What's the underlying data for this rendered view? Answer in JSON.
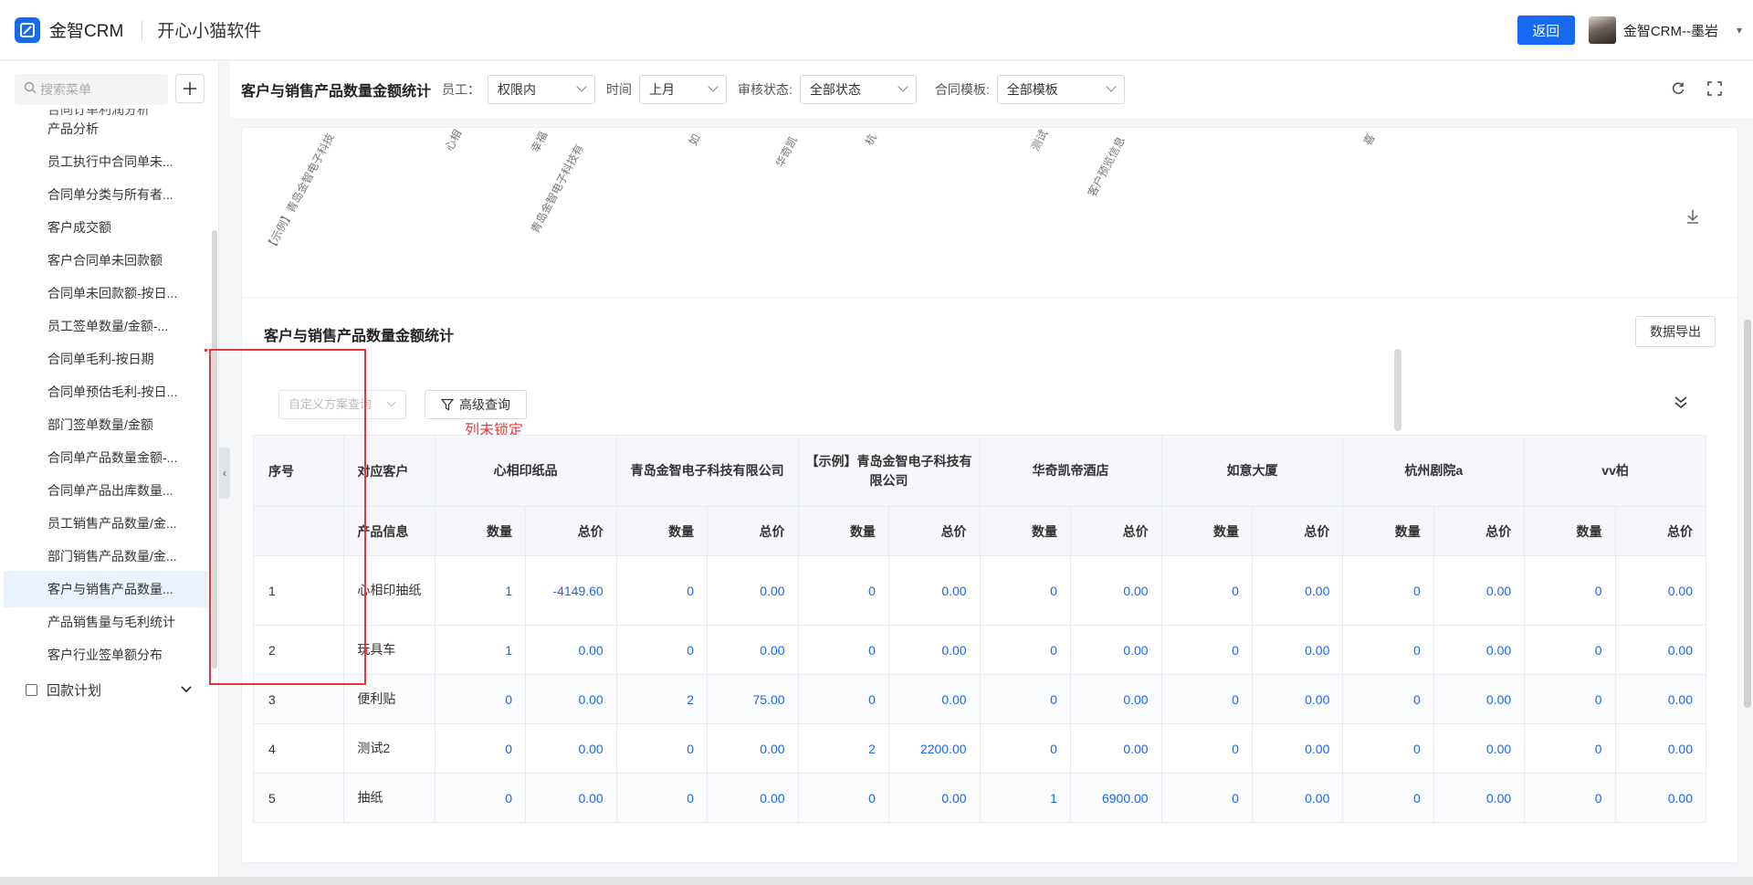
{
  "header": {
    "logo_text": "金智CRM",
    "company": "开心小猫软件",
    "back_label": "返回",
    "user_name": "金智CRM--墨岩"
  },
  "sidebar": {
    "search_placeholder": "搜索菜单",
    "cut_item": "合同订单利润分析",
    "items": [
      "产品分析",
      "员工执行中合同单未...",
      "合同单分类与所有者...",
      "客户成交额",
      "客户合同单未回款额",
      "合同单未回款额-按日...",
      "员工签单数量/金额-...",
      "合同单毛利-按日期",
      "合同单预估毛利-按日...",
      "部门签单数量/金额",
      "合同单产品数量金额-...",
      "合同单产品出库数量...",
      "员工销售产品数量/金...",
      "部门销售产品数量/金...",
      "客户与销售产品数量...",
      "产品销售量与毛利统计",
      "客户行业签单额分布"
    ],
    "active_index": 14,
    "group": "回款计划"
  },
  "filters": {
    "page_title": "客户与销售产品数量金额统计",
    "employee_label": "员工：",
    "employee_value": "权限内",
    "time_label": "时间",
    "time_value": "上月",
    "audit_label": "审核状态:",
    "audit_value": "全部状态",
    "template_label": "合同模板:",
    "template_value": "全部模板"
  },
  "chart_labels": [
    "【示例】青岛金智电子科技",
    "心相",
    "幸福",
    "青岛金智电子科技有",
    "如",
    "华奇凯",
    "杭",
    "测试",
    "客户预览信息",
    "喜"
  ],
  "table_card": {
    "title": "客户与销售产品数量金额统计",
    "export_label": "数据导出",
    "scheme_placeholder": "自定义方案查询",
    "advanced_label": "高级查询",
    "annotation": "列未锁定"
  },
  "table": {
    "col_index": "序号",
    "col_customer": "对应客户",
    "col_product": "产品信息",
    "sub_qty": "数量",
    "sub_total": "总价",
    "customers": [
      "心相印纸品",
      "青岛金智电子科技有限公司",
      "【示例】青岛金智电子科技有限公司",
      "华奇凯帝酒店",
      "如意大厦",
      "杭州剧院a",
      "vv柏"
    ],
    "rows": [
      {
        "idx": "1",
        "product": "心相印抽纸",
        "cells": [
          "1",
          "-4149.60",
          "0",
          "0.00",
          "0",
          "0.00",
          "0",
          "0.00",
          "0",
          "0.00",
          "0",
          "0.00",
          "0",
          "0.00"
        ]
      },
      {
        "idx": "2",
        "product": "玩具车",
        "cells": [
          "1",
          "0.00",
          "0",
          "0.00",
          "0",
          "0.00",
          "0",
          "0.00",
          "0",
          "0.00",
          "0",
          "0.00",
          "0",
          "0.00"
        ]
      },
      {
        "idx": "3",
        "product": "便利贴",
        "cells": [
          "0",
          "0.00",
          "2",
          "75.00",
          "0",
          "0.00",
          "0",
          "0.00",
          "0",
          "0.00",
          "0",
          "0.00",
          "0",
          "0.00"
        ]
      },
      {
        "idx": "4",
        "product": "测试2",
        "cells": [
          "0",
          "0.00",
          "0",
          "0.00",
          "2",
          "2200.00",
          "0",
          "0.00",
          "0",
          "0.00",
          "0",
          "0.00",
          "0",
          "0.00"
        ]
      },
      {
        "idx": "5",
        "product": "抽纸",
        "cells": [
          "0",
          "0.00",
          "0",
          "0.00",
          "0",
          "0.00",
          "1",
          "6900.00",
          "0",
          "0.00",
          "0",
          "0.00",
          "0",
          "0.00"
        ]
      }
    ]
  },
  "colors": {
    "accent": "#1869f2",
    "link_number": "#1a66f0",
    "annotation_red": "#e8373a"
  }
}
